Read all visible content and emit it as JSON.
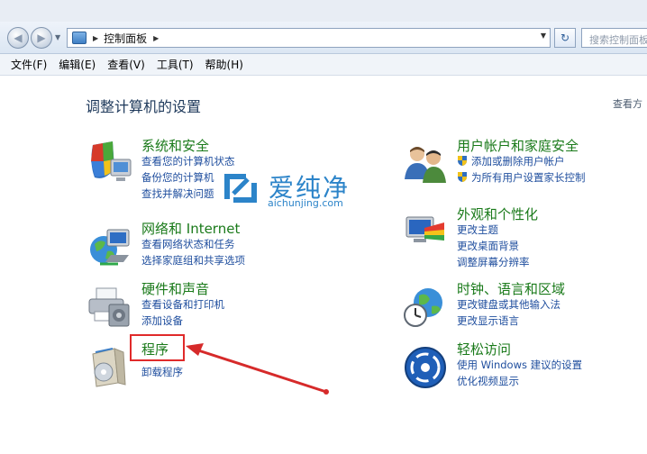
{
  "address": {
    "crumb": "控制面板",
    "search_placeholder": "搜索控制面板"
  },
  "menu": [
    "文件(F)",
    "编辑(E)",
    "查看(V)",
    "工具(T)",
    "帮助(H)"
  ],
  "page_title": "调整计算机的设置",
  "view_by": "查看方",
  "categories": [
    {
      "title": "系统和安全",
      "links": [
        "查看您的计算机状态",
        "备份您的计算机",
        "查找并解决问题"
      ]
    },
    {
      "title": "网络和 Internet",
      "links": [
        "查看网络状态和任务",
        "选择家庭组和共享选项"
      ]
    },
    {
      "title": "硬件和声音",
      "links": [
        "查看设备和打印机",
        "添加设备"
      ]
    },
    {
      "title": "程序",
      "links": [
        "卸载程序"
      ]
    },
    {
      "title": "用户帐户和家庭安全",
      "links": [
        "添加或删除用户帐户",
        "为所有用户设置家长控制"
      ]
    },
    {
      "title": "外观和个性化",
      "links": [
        "更改主题",
        "更改桌面背景",
        "调整屏幕分辨率"
      ]
    },
    {
      "title": "时钟、语言和区域",
      "links": [
        "更改键盘或其他输入法",
        "更改显示语言"
      ]
    },
    {
      "title": "轻松访问",
      "links": [
        "使用 Windows 建议的设置",
        "优化视频显示"
      ]
    }
  ],
  "watermark": {
    "text": "爱纯净",
    "url": "aichunjing.com"
  },
  "colors": {
    "title_green": "#1a7a1a",
    "link_blue": "#1f4e9e",
    "highlight_red": "#e02a2a"
  }
}
